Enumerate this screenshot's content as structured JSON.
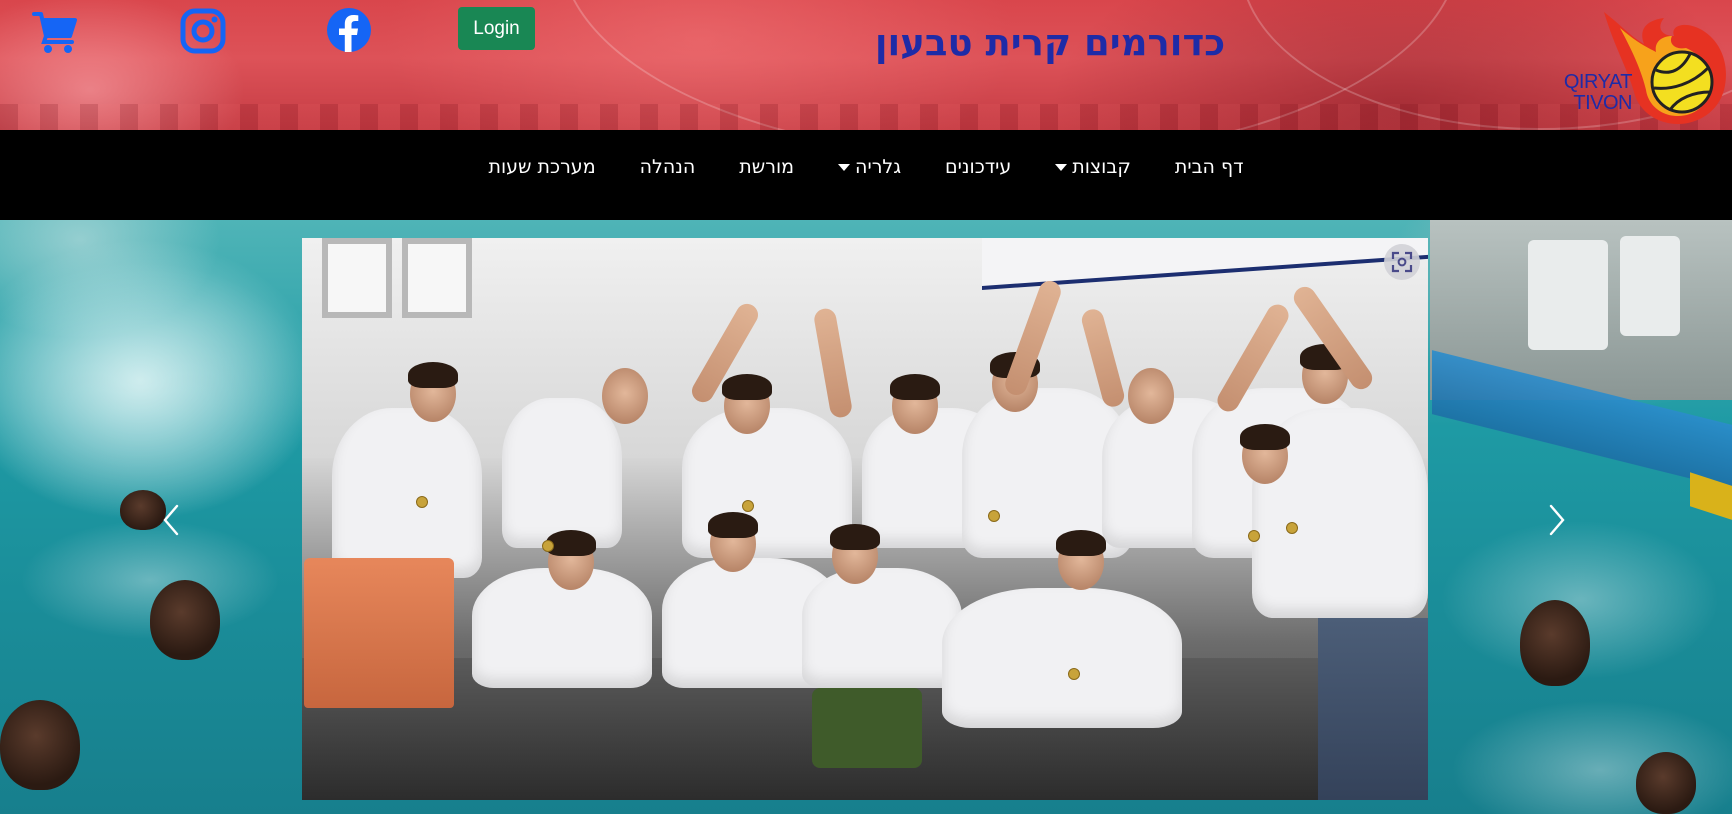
{
  "header": {
    "title": "כדורמים קרית טבעון",
    "login_label": "Login",
    "logo_line1": "QIRYAT",
    "logo_line2": "TIVON",
    "icons": [
      "cart-icon",
      "instagram-icon",
      "facebook-icon"
    ],
    "colors": {
      "title": "#1e2ba7",
      "login_bg": "#198754",
      "icon_blue": "#1565f5",
      "header_bg": "#d9464c"
    }
  },
  "nav": {
    "items": [
      {
        "label": "דף הבית",
        "dropdown": false
      },
      {
        "label": "קבוצות",
        "dropdown": true
      },
      {
        "label": "עידכונים",
        "dropdown": false
      },
      {
        "label": "גלריה",
        "dropdown": true
      },
      {
        "label": "מורשת",
        "dropdown": false
      },
      {
        "label": "הנהלה",
        "dropdown": false
      },
      {
        "label": "מערכת שעות",
        "dropdown": false
      }
    ]
  },
  "carousel": {
    "prev_icon": "chevron-left-icon",
    "next_icon": "chevron-right-icon",
    "expand_icon": "fullscreen-icon"
  }
}
